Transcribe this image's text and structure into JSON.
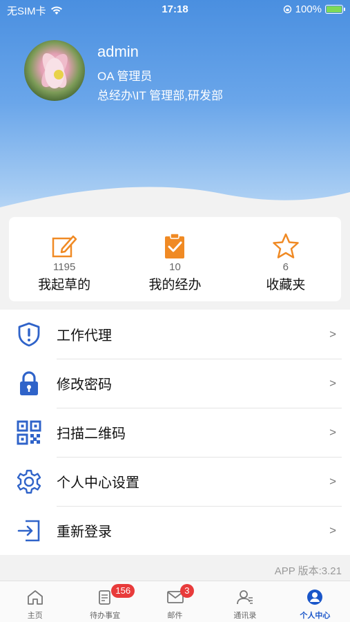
{
  "status_bar": {
    "carrier": "无SIM卡",
    "time": "17:18",
    "battery": "100%"
  },
  "profile": {
    "name": "admin",
    "role": "OA 管理员",
    "department": "总经办\\IT 管理部,研发部"
  },
  "stats": [
    {
      "icon": "edit-icon",
      "count": "1195",
      "label": "我起草的"
    },
    {
      "icon": "clipboard-check-icon",
      "count": "10",
      "label": "我的经办"
    },
    {
      "icon": "star-icon",
      "count": "6",
      "label": "收藏夹"
    }
  ],
  "menu": [
    {
      "icon": "shield-alert-icon",
      "label": "工作代理",
      "arrow": ">"
    },
    {
      "icon": "lock-icon",
      "label": "修改密码",
      "arrow": ">"
    },
    {
      "icon": "qr-code-icon",
      "label": "扫描二维码",
      "arrow": ">"
    },
    {
      "icon": "gear-icon",
      "label": "个人中心设置",
      "arrow": ">"
    },
    {
      "icon": "logout-icon",
      "label": "重新登录",
      "arrow": ">"
    }
  ],
  "version": "APP 版本:3.21",
  "tabbar": [
    {
      "icon": "home-icon",
      "label": "主页",
      "badge": ""
    },
    {
      "icon": "todo-icon",
      "label": "待办事宜",
      "badge": "156"
    },
    {
      "icon": "mail-icon",
      "label": "邮件",
      "badge": "3"
    },
    {
      "icon": "contacts-icon",
      "label": "通讯录",
      "badge": ""
    },
    {
      "icon": "user-icon",
      "label": "个人中心",
      "badge": "",
      "active": true
    }
  ],
  "colors": {
    "accent": "#2f63c9",
    "stat_icon": "#f08a24",
    "badge": "#e83b3b",
    "header_top": "#4a8fe0"
  }
}
